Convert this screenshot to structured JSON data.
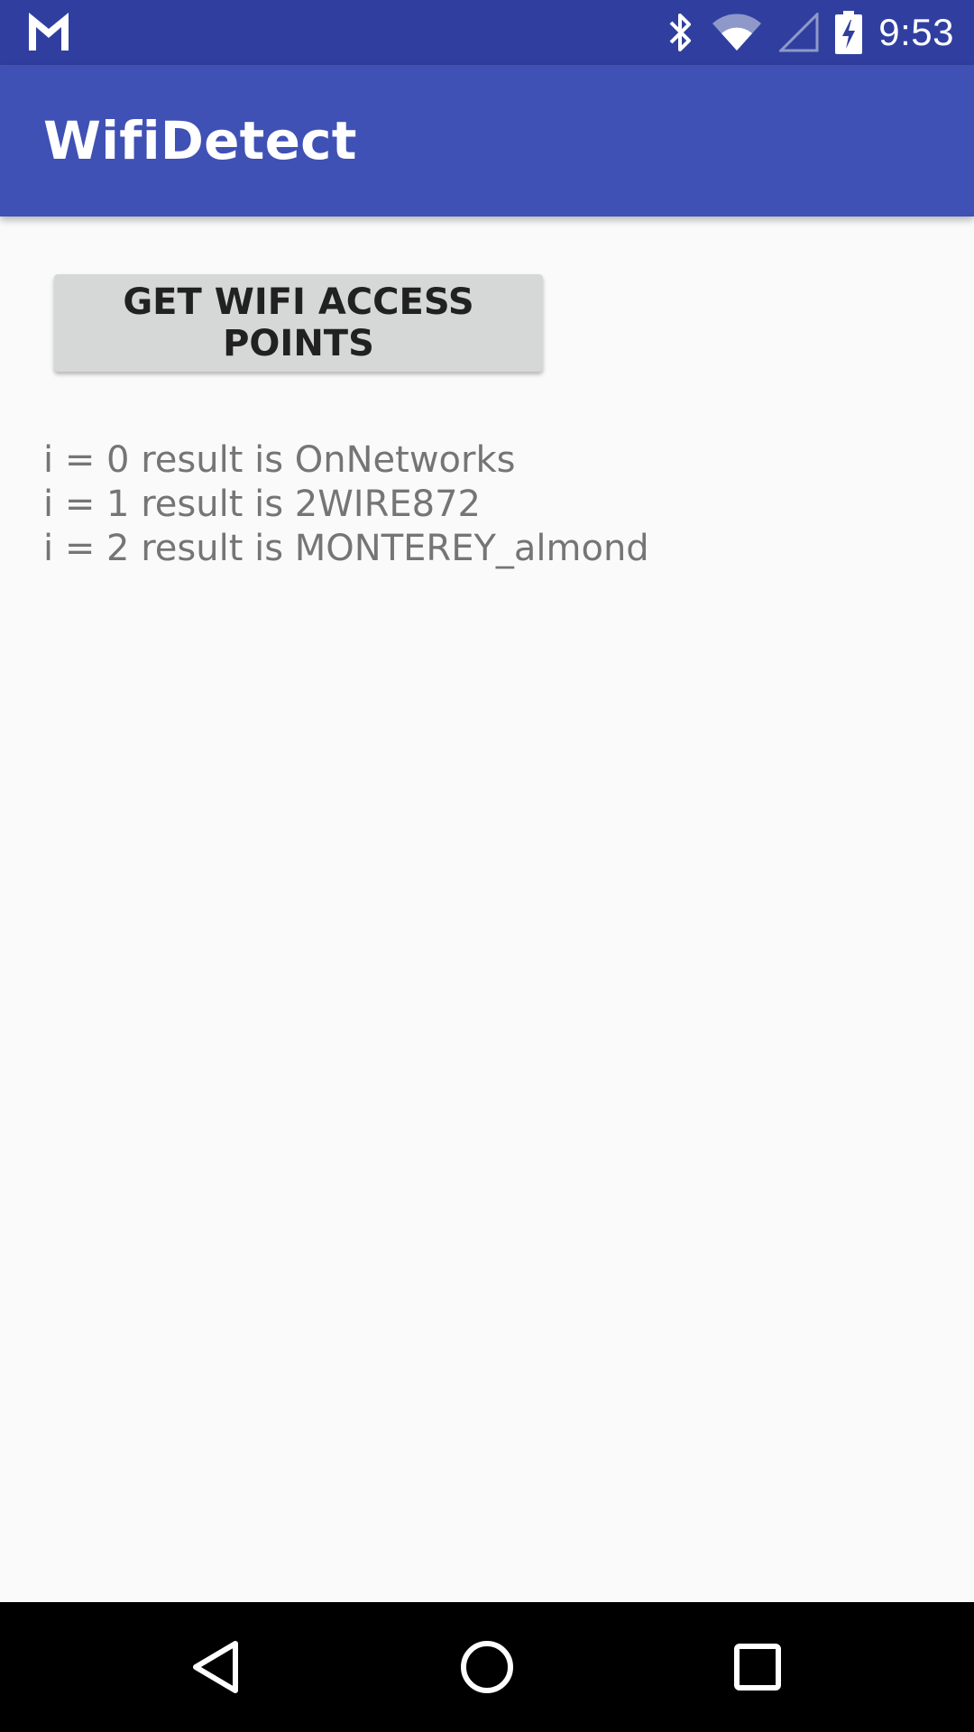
{
  "status_bar": {
    "time": "9:53",
    "icons": [
      "gmail-icon",
      "bluetooth-icon",
      "wifi-icon",
      "cell-signal-icon",
      "battery-charging-icon"
    ],
    "color": "#303f9f"
  },
  "app_bar": {
    "title": "WifiDetect",
    "color": "#3f51b5"
  },
  "main": {
    "button_label": "GET WIFI ACCESS POINTS",
    "results": [
      "i = 0 result is OnNetworks",
      "i = 1 result is 2WIRE872",
      "i = 2 result is MONTEREY_almond"
    ]
  },
  "nav_bar": {
    "buttons": [
      "back-icon",
      "home-icon",
      "recents-icon"
    ]
  }
}
